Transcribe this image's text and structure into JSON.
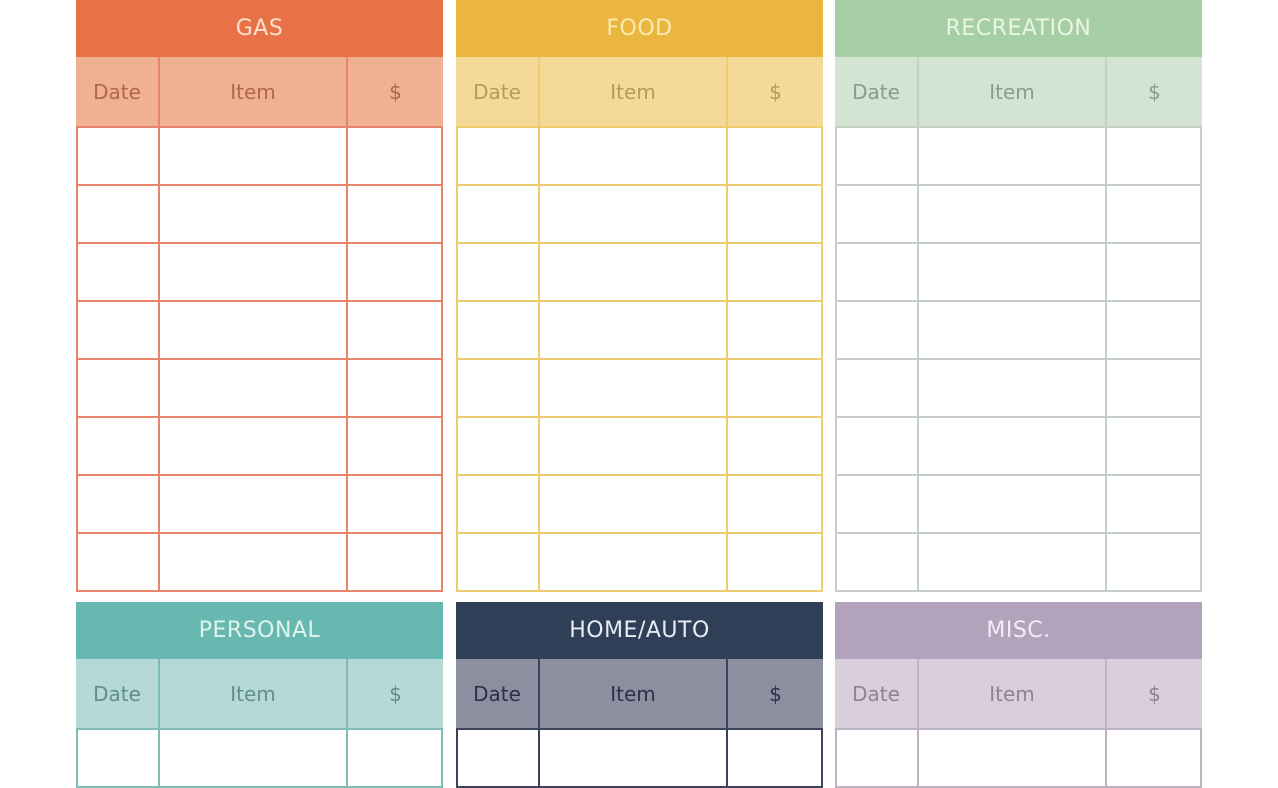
{
  "columns": [
    "Date",
    "Item",
    "$"
  ],
  "tables": [
    {
      "title": "GAS",
      "title_bg": "#e87148",
      "title_fg": "#fbe2cf",
      "header_bg": "#f0b092",
      "header_fg": "#b0664b",
      "line": "#e6846c",
      "rows": 8
    },
    {
      "title": "FOOD",
      "title_bg": "#ebb640",
      "title_fg": "#fbeab0",
      "header_bg": "#f4d999",
      "header_fg": "#b89a58",
      "line": "#f0cc70",
      "rows": 8
    },
    {
      "title": "RECREATION",
      "title_bg": "#a7cfa6",
      "title_fg": "#eaf5e3",
      "header_bg": "#d3e4d2",
      "header_fg": "#8a9c8a",
      "line": "#c6cfc6",
      "rows": 8
    },
    {
      "title": "PERSONAL",
      "title_bg": "#67b8b0",
      "title_fg": "#e0f4ee",
      "header_bg": "#b4d9d6",
      "header_fg": "#5f8e8b",
      "line": "#7fbcb6",
      "rows": 1
    },
    {
      "title": "HOME/AUTO",
      "title_bg": "#2f3f58",
      "title_fg": "#e8ecf2",
      "header_bg": "#8c8f9f",
      "header_fg": "#2c3145",
      "line": "#3c4358",
      "rows": 1
    },
    {
      "title": "MISC.",
      "title_bg": "#b2a2bb",
      "title_fg": "#f2ecf5",
      "header_bg": "#d9cfdc",
      "header_fg": "#8e8294",
      "line": "#bdb3c2",
      "rows": 1
    }
  ]
}
